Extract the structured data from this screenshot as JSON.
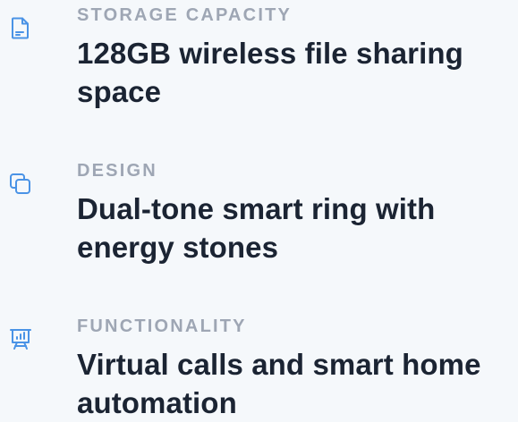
{
  "features": [
    {
      "icon": "document-icon",
      "label": "STORAGE CAPACITY",
      "title": "128GB wireless file sharing space"
    },
    {
      "icon": "stacked-squares-icon",
      "label": "DESIGN",
      "title": "Dual-tone smart ring with energy stones"
    },
    {
      "icon": "presentation-chart-icon",
      "label": "FUNCTIONALITY",
      "title": "Virtual calls and smart home automation"
    }
  ],
  "colors": {
    "background": "#f5f8fb",
    "icon": "#4a93e6",
    "label": "#9ea6b4",
    "title": "#1b2433"
  }
}
